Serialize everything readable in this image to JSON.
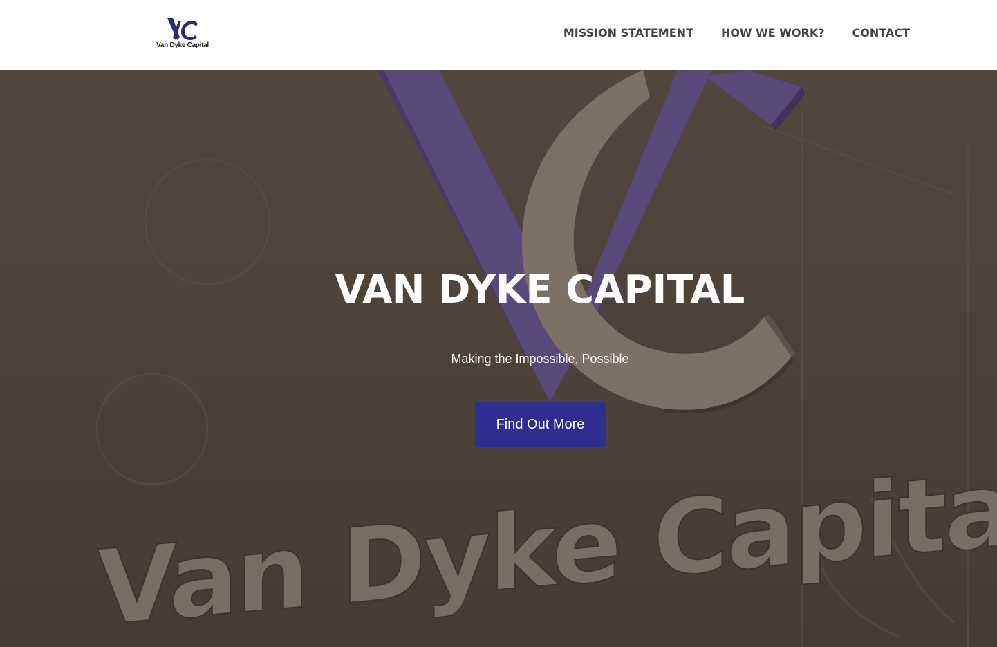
{
  "brand": {
    "logo_monogram": "VC",
    "logo_text": "Van Dyke Capital",
    "colors": {
      "primary_blue": "#2d2e8f",
      "logo_blue": "#2b2a7a",
      "hero_overlay": "#4d4339"
    }
  },
  "nav": {
    "items": [
      {
        "label": "MISSION STATEMENT"
      },
      {
        "label": "HOW WE WORK?"
      },
      {
        "label": "CONTACT"
      }
    ]
  },
  "hero": {
    "title": "VAN DYKE CAPITAL",
    "subtitle": "Making the Impossible, Possible",
    "cta_label": "Find Out More",
    "background_sign_text": "Van Dyke Capital"
  }
}
